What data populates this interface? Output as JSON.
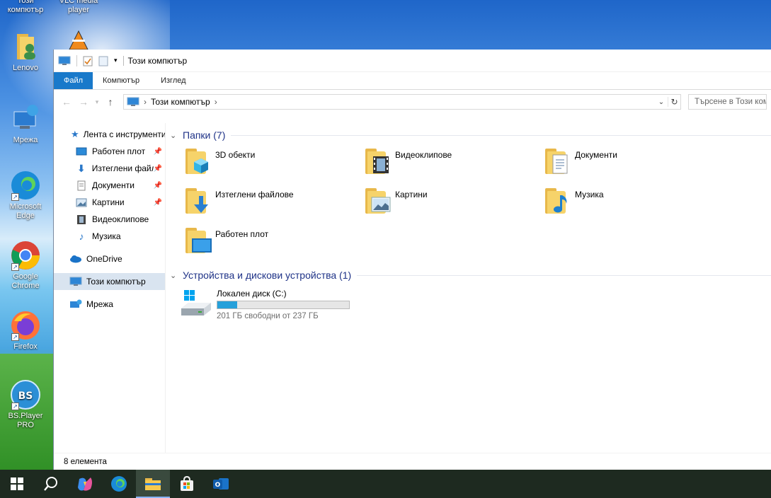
{
  "desktop": {
    "icons": [
      {
        "label": "Този\nкомпютър"
      },
      {
        "label": "VLC media\nplayer"
      },
      {
        "label": "Lenovo"
      },
      {
        "label": "Мрежа"
      },
      {
        "label": "Microsoft\nEdge"
      },
      {
        "label": "Google\nChrome"
      },
      {
        "label": "Firefox"
      },
      {
        "label": "BS.Player\nPRO"
      }
    ]
  },
  "window": {
    "title": "Този компютър",
    "ribbon": {
      "file": "Файл",
      "computer": "Компютър",
      "view": "Изглед"
    },
    "address": {
      "crumb": "Този компютър"
    },
    "search_placeholder": "Търсене в Този компютър",
    "nav": [
      {
        "label": "Лента с инструменти",
        "icon": "star-icon"
      },
      {
        "label": "Работен плот",
        "icon": "desktop-icon",
        "pinned": true
      },
      {
        "label": "Изтеглени файлове",
        "icon": "download-icon",
        "pinned": true
      },
      {
        "label": "Документи",
        "icon": "document-icon",
        "pinned": true
      },
      {
        "label": "Картини",
        "icon": "pictures-icon",
        "pinned": true
      },
      {
        "label": "Видеоклипове",
        "icon": "video-icon"
      },
      {
        "label": "Музика",
        "icon": "music-icon"
      },
      {
        "label": "OneDrive",
        "icon": "cloud-icon"
      },
      {
        "label": "Този компютър",
        "icon": "computer-icon"
      },
      {
        "label": "Мрежа",
        "icon": "network-icon"
      }
    ],
    "folders_header": "Папки (7)",
    "folders": [
      {
        "label": "3D обекти",
        "icon": "3d-objects-icon"
      },
      {
        "label": "Видеоклипове",
        "icon": "video-icon"
      },
      {
        "label": "Документи",
        "icon": "document-icon"
      },
      {
        "label": "Изтеглени файлове",
        "icon": "download-icon"
      },
      {
        "label": "Картини",
        "icon": "pictures-icon"
      },
      {
        "label": "Музика",
        "icon": "music-icon"
      },
      {
        "label": "Работен плот",
        "icon": "desktop-icon"
      }
    ],
    "devices_header": "Устройства и дискови устройства (1)",
    "drive": {
      "label": "Локален диск (C:)",
      "free_text": "201 ГБ свободни от 237 ГБ",
      "used_fraction": 0.15
    },
    "status": "8 елемента"
  },
  "colors": {
    "accent": "#1979ca",
    "group_header": "#1e3287",
    "bar_fill": "#26a0da"
  }
}
